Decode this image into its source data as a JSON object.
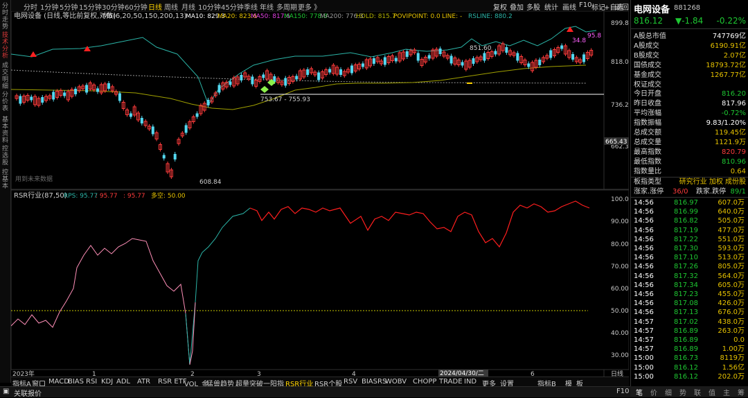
{
  "left_tabs": [
    {
      "label": "分时走势",
      "active": false
    },
    {
      "label": "技术分析",
      "active": true
    },
    {
      "label": "成交明细",
      "active": false
    },
    {
      "label": "分价表",
      "active": false
    },
    {
      "label": "基本资料",
      "active": false
    },
    {
      "label": "控选股",
      "active": false
    },
    {
      "label": "控基本",
      "active": false
    }
  ],
  "periods": [
    {
      "label": "分时",
      "active": false
    },
    {
      "label": "1分钟",
      "active": false
    },
    {
      "label": "5分钟",
      "active": false
    },
    {
      "label": "15分钟",
      "active": false
    },
    {
      "label": "30分钟",
      "active": false
    },
    {
      "label": "60分钟",
      "active": false
    },
    {
      "label": "日线",
      "active": true
    },
    {
      "label": "周线",
      "active": false
    },
    {
      "label": "月线",
      "active": false
    },
    {
      "label": "10分钟",
      "active": false
    },
    {
      "label": "45分钟",
      "active": false
    },
    {
      "label": "季线",
      "active": false
    },
    {
      "label": "年线",
      "active": false
    },
    {
      "label": "多周期",
      "active": false
    },
    {
      "label": "更多 》",
      "active": false
    }
  ],
  "toolbar": [
    "复权",
    "叠加",
    "多股",
    "统计",
    "画线",
    "F10",
    "标记",
    "+自选",
    "返回"
  ],
  "main_chart": {
    "title": "电网设备 (日线,等比前复权,对数)",
    "indicator_name": "M6(6,20,50,150,200,13)",
    "indicators": [
      {
        "label": "MA10: 829.3",
        "color": "#ffffff"
      },
      {
        "label": "MA20: 823.6",
        "color": "#e6c200"
      },
      {
        "label": "MA50: 817.6",
        "color": "#e040e0"
      },
      {
        "label": "MA150: 778.8",
        "color": "#1ec832"
      },
      {
        "label": "MA200: 776.3",
        "color": "#9a9a9a"
      },
      {
        "label": "HOLD: 815.7",
        "color": "#b0b000"
      },
      {
        "label": "POVIPOINT: 0.0",
        "color": "#e6c200"
      },
      {
        "label": "LINE: -",
        "color": "#e6c200"
      },
      {
        "label": "RSLINE: 880.2",
        "color": "#2bb5a8"
      }
    ],
    "y_ticks": [
      "899.8",
      "818.0",
      "736.2",
      "662.3"
    ],
    "current_price_tag": "665.43",
    "annotations": [
      "851.60",
      "753.67 - 755.93",
      "608.84",
      "34.8",
      "95.8"
    ],
    "future_data_note": "用到未来数据"
  },
  "rsr_panel": {
    "title": "RSR行业(87,50)",
    "indicators": [
      {
        "label": "RPS: 95.77",
        "color": "#2bb5a8"
      },
      {
        "label": ": 95.77",
        "color": "#ff3c3c"
      },
      {
        "label": ": 95.77",
        "color": "#ff3c3c"
      },
      {
        "label": "多空: 50.00",
        "color": "#e6c200"
      }
    ],
    "y_ticks": [
      "100.0",
      "90.00",
      "80.00",
      "70.00",
      "60.00",
      "50.00",
      "40.00",
      "30.00"
    ]
  },
  "x_axis": {
    "labels": [
      "2023年",
      "1",
      "2",
      "3",
      "4",
      "5",
      "6"
    ],
    "date_box": "2024/04/30/二",
    "right_label": "日线"
  },
  "bottom_tabs": [
    {
      "label": "指标A",
      "active": false
    },
    {
      "label": "窗口",
      "active": false
    },
    {
      "label": "MACD",
      "active": false
    },
    {
      "label": "BIAS",
      "active": false
    },
    {
      "label": "RSI",
      "active": false
    },
    {
      "label": "KDJ",
      "active": false
    },
    {
      "label": "ADL",
      "active": false
    },
    {
      "label": "ATR",
      "active": false
    },
    {
      "label": "RSR ETF",
      "active": false
    },
    {
      "label": "VOL_金",
      "active": false
    },
    {
      "label": "猛兽趋势",
      "active": false
    },
    {
      "label": "超量突破",
      "active": false
    },
    {
      "label": "一阳指",
      "active": false
    },
    {
      "label": "RSR行业",
      "active": true
    },
    {
      "label": "RSR个股",
      "active": false
    },
    {
      "label": "RSV",
      "active": false
    },
    {
      "label": "BIASRS",
      "active": false
    },
    {
      "label": "WOBV",
      "active": false
    },
    {
      "label": "CHOPP",
      "active": false
    },
    {
      "label": "TRADE",
      "active": false
    },
    {
      "label": "IND",
      "active": false
    },
    {
      "label": "更多",
      "active": false
    },
    {
      "label": "设置",
      "active": false
    },
    {
      "label": "指标B",
      "active": false
    },
    {
      "label": "模",
      "active": false
    },
    {
      "label": "板",
      "active": false
    }
  ],
  "status_bar": {
    "label": "关联报价",
    "key": "F10"
  },
  "quote": {
    "name": "电网设备",
    "code": "881268",
    "price": "816.12",
    "change": "▼-1.84",
    "change_pct": "-0.22%",
    "fields": [
      {
        "label": "A股总市值",
        "value": "747769亿",
        "color": "white"
      },
      {
        "label": "A股成交",
        "value": "6190.91亿",
        "color": "yellow"
      },
      {
        "label": "B股成交",
        "value": "2.07亿",
        "color": "yellow"
      },
      {
        "label": "国债成交",
        "value": "18793.72亿",
        "color": "yellow"
      },
      {
        "label": "基金成交",
        "value": "1267.77亿",
        "color": "yellow"
      },
      {
        "label": "权证成交",
        "value": "",
        "color": "yellow"
      },
      {
        "label": "今日开盘",
        "value": "816.20",
        "color": "green"
      },
      {
        "label": "昨日收盘",
        "value": "817.96",
        "color": "white"
      },
      {
        "label": "平均涨幅",
        "value": "-0.72%",
        "color": "green"
      },
      {
        "label": "指数振幅",
        "value": "9.83/1.20%",
        "color": "white"
      },
      {
        "label": "总成交额",
        "value": "119.45亿",
        "color": "yellow"
      },
      {
        "label": "总成交量",
        "value": "1121.9万",
        "color": "yellow"
      },
      {
        "label": "最高指数",
        "value": "820.79",
        "color": "red"
      },
      {
        "label": "最低指数",
        "value": "810.96",
        "color": "green"
      },
      {
        "label": "指数量比",
        "value": "0.64",
        "color": "yellow"
      }
    ],
    "board_type_label": "板指类型",
    "board_type_value": "研究行业 加权 成份股",
    "updown": {
      "label1": "涨家.涨停",
      "val1": "36/0",
      "label2": "跌家.跌停",
      "val2": "89/1"
    },
    "trades": [
      {
        "time": "14:56",
        "price": "816.97",
        "vol": "607.0万"
      },
      {
        "time": "14:56",
        "price": "816.99",
        "vol": "640.0万"
      },
      {
        "time": "14:56",
        "price": "816.82",
        "vol": "505.0万"
      },
      {
        "time": "14:56",
        "price": "817.19",
        "vol": "477.0万"
      },
      {
        "time": "14:56",
        "price": "817.22",
        "vol": "551.0万"
      },
      {
        "time": "14:56",
        "price": "817.30",
        "vol": "593.0万"
      },
      {
        "time": "14:56",
        "price": "817.10",
        "vol": "513.0万"
      },
      {
        "time": "14:56",
        "price": "817.26",
        "vol": "805.0万"
      },
      {
        "time": "14:56",
        "price": "817.32",
        "vol": "564.0万"
      },
      {
        "time": "14:56",
        "price": "817.34",
        "vol": "605.0万"
      },
      {
        "time": "14:56",
        "price": "817.23",
        "vol": "455.0万"
      },
      {
        "time": "14:56",
        "price": "817.08",
        "vol": "426.0万"
      },
      {
        "time": "14:56",
        "price": "817.13",
        "vol": "676.0万"
      },
      {
        "time": "14:57",
        "price": "817.02",
        "vol": "438.0万"
      },
      {
        "time": "14:57",
        "price": "816.89",
        "vol": "263.0万"
      },
      {
        "time": "14:57",
        "price": "816.89",
        "vol": "0.0"
      },
      {
        "time": "14:57",
        "price": "816.89",
        "vol": "1.00万"
      },
      {
        "time": "15:00",
        "price": "816.73",
        "vol": "8119万"
      },
      {
        "time": "15:00",
        "price": "816.12",
        "vol": "1.56亿"
      },
      {
        "time": "15:00",
        "price": "816.12",
        "vol": "202.0万"
      }
    ],
    "bottom_tabs": [
      "笔",
      "价",
      "细",
      "势",
      "联",
      "值",
      "主",
      "筹"
    ]
  },
  "colors": {
    "up": "#ff3c3c",
    "down": "#54d8f0",
    "ma_white": "#ffffff",
    "ma_yellow": "#e6c200",
    "rs_line": "#2bb5a8"
  }
}
